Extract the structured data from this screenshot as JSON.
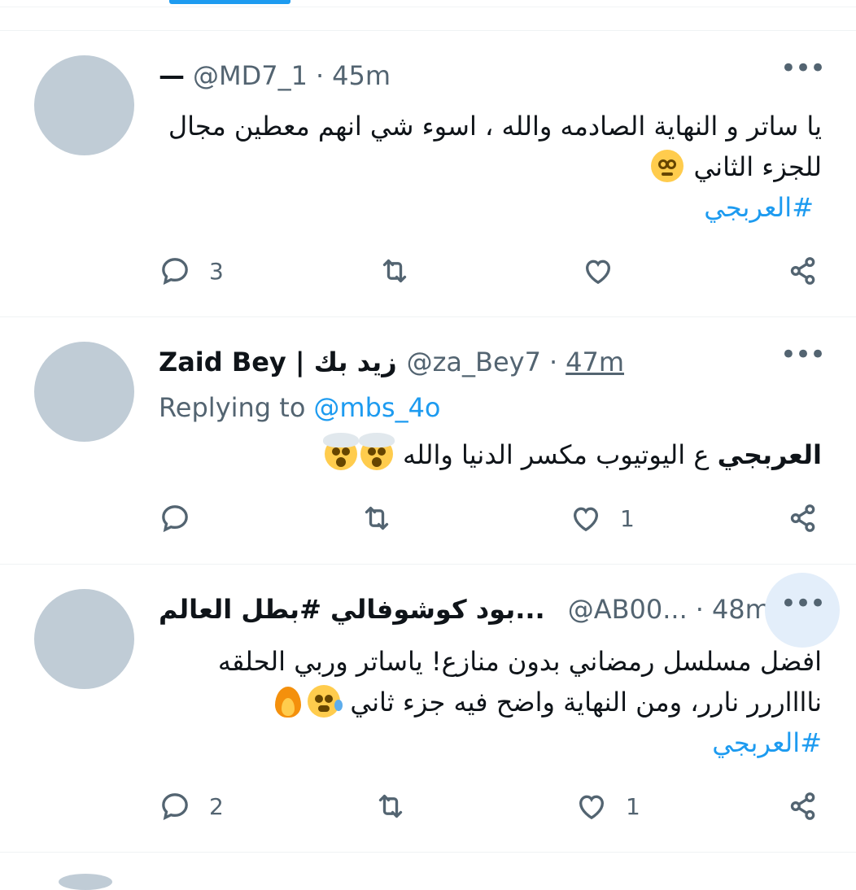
{
  "tweets": [
    {
      "display_name": "—",
      "handle": "@MD7_1",
      "time": "45m",
      "text_lines": [
        "يا ساتر و النهاية الصادمه والله ، اسوء شي انهم معطين مجال",
        "للجزء الثاني"
      ],
      "emoji": [
        "face-with-spiral-eyes"
      ],
      "hashtag": "#العربجي",
      "replies": "3",
      "retweets": "",
      "likes": ""
    },
    {
      "display_name": "Zaid Bey | زيد بك",
      "handle": "@za_Bey7",
      "time": "47m",
      "replying_prefix": "Replying to",
      "replying_to": "@mbs_4o",
      "text_bold": "العربجي",
      "text_rest": " ع اليوتيوب مكسر الدنيا والله",
      "emoji": [
        "exploding-head",
        "exploding-head"
      ],
      "replies": "",
      "retweets": "",
      "likes": "1"
    },
    {
      "display_name": "...بود كوشوفالي #بطل العالم",
      "handle": "@AB00...",
      "time": "48m",
      "text_lines": [
        "افضل مسلسل رمضاني بدون منازع! ياساتر وربي الحلقه",
        "نااااررر نارر، ومن النهاية واضح فيه جزء ثاني"
      ],
      "emoji": [
        "anxious-face-with-sweat",
        "fire"
      ],
      "hashtag": "#العربجي",
      "replies": "2",
      "retweets": "",
      "likes": "1"
    }
  ],
  "icons": {
    "more": "more-horizontal-icon",
    "reply": "reply-bubble-icon",
    "retweet": "retweet-icon",
    "like": "heart-icon",
    "share": "share-icon"
  },
  "colors": {
    "accent": "#1d9bf0",
    "muted": "#536471",
    "avatar": "#c0ccd6"
  }
}
